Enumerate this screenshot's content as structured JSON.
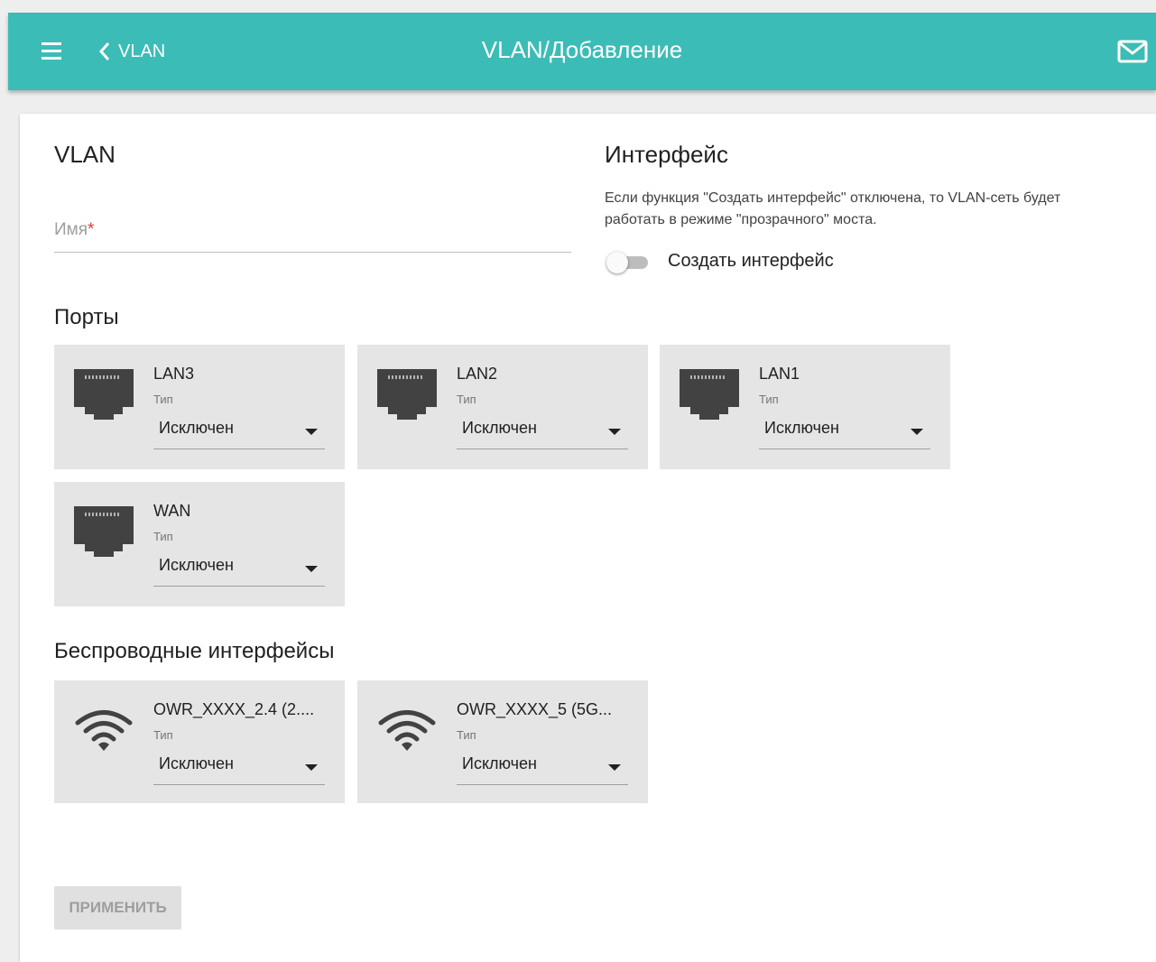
{
  "header": {
    "back_label": "VLAN",
    "title": "VLAN/Добавление",
    "icons": [
      "menu-icon",
      "chevron-left-icon",
      "mail-icon"
    ]
  },
  "vlan": {
    "heading": "VLAN",
    "name_label": "Имя",
    "name_required_mark": "*",
    "name_value": ""
  },
  "interface": {
    "heading": "Интерфейс",
    "description": "Если функция \"Создать интерфейс\" отключена, то VLAN-сеть будет работать в режиме \"прозрачного\" моста.",
    "toggle_label": "Создать интерфейс",
    "toggle_on": false
  },
  "ports": {
    "heading": "Порты",
    "items": [
      {
        "name": "LAN3",
        "type_label": "Тип",
        "value": "Исключен",
        "icon": "ethernet-port-icon"
      },
      {
        "name": "LAN2",
        "type_label": "Тип",
        "value": "Исключен",
        "icon": "ethernet-port-icon"
      },
      {
        "name": "LAN1",
        "type_label": "Тип",
        "value": "Исключен",
        "icon": "ethernet-port-icon"
      },
      {
        "name": "WAN",
        "type_label": "Тип",
        "value": "Исключен",
        "icon": "ethernet-port-icon"
      }
    ]
  },
  "wireless": {
    "heading": "Беспроводные интерфейсы",
    "items": [
      {
        "name": "OWR_XXXX_2.4 (2....",
        "type_label": "Тип",
        "value": "Исключен",
        "icon": "wifi-icon"
      },
      {
        "name": "OWR_XXXX_5 (5G...",
        "type_label": "Тип",
        "value": "Исключен",
        "icon": "wifi-icon"
      }
    ]
  },
  "apply_label": "ПРИМЕНИТЬ",
  "colors": {
    "header": "#3cbcb6",
    "card_bg": "#e5e5e5",
    "page_bg": "#eeeeee",
    "required": "#e53935"
  }
}
